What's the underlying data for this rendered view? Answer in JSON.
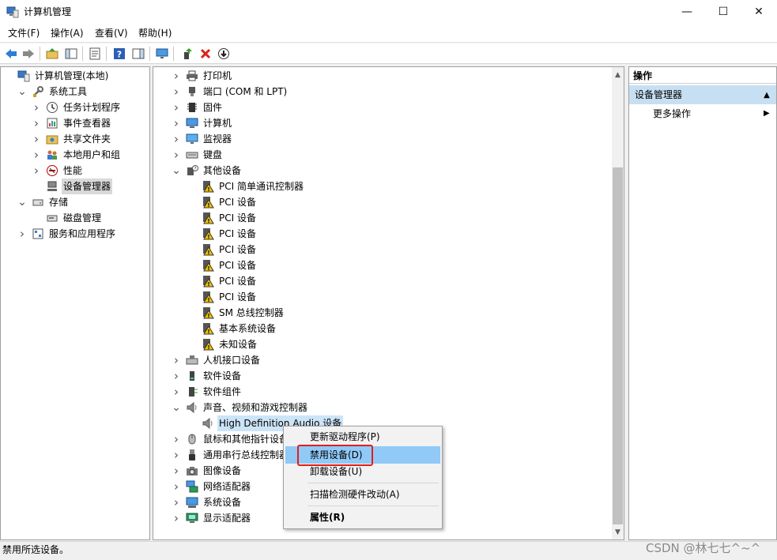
{
  "window": {
    "title": "计算机管理",
    "minimize": "—",
    "maximize": "☐",
    "close": "✕"
  },
  "menu": [
    "文件(F)",
    "操作(A)",
    "查看(V)",
    "帮助(H)"
  ],
  "toolbar": {
    "icons": [
      "back-arrow-icon",
      "forward-arrow-icon",
      "up-folder-icon",
      "show-hide-tree-icon",
      "properties-icon",
      "help-icon",
      "show-action-pane-icon",
      "monitor-icon",
      "update-driver-icon",
      "uninstall-icon",
      "disable-device-icon"
    ]
  },
  "left_tree": [
    {
      "label": "计算机管理(本地)",
      "icon": "computer-management-icon",
      "level": 0,
      "arrow": ""
    },
    {
      "label": "系统工具",
      "icon": "system-tools-icon",
      "level": 1,
      "arrow": "v"
    },
    {
      "label": "任务计划程序",
      "icon": "clock-icon",
      "level": 2,
      "arrow": ">"
    },
    {
      "label": "事件查看器",
      "icon": "event-viewer-icon",
      "level": 2,
      "arrow": ">"
    },
    {
      "label": "共享文件夹",
      "icon": "shared-folder-icon",
      "level": 2,
      "arrow": ">"
    },
    {
      "label": "本地用户和组",
      "icon": "users-icon",
      "level": 2,
      "arrow": ">"
    },
    {
      "label": "性能",
      "icon": "performance-icon",
      "level": 2,
      "arrow": ">"
    },
    {
      "label": "设备管理器",
      "icon": "device-manager-icon",
      "level": 2,
      "arrow": "",
      "selected": true
    },
    {
      "label": "存储",
      "icon": "storage-icon",
      "level": 1,
      "arrow": "v"
    },
    {
      "label": "磁盘管理",
      "icon": "disk-management-icon",
      "level": 2,
      "arrow": ""
    },
    {
      "label": "服务和应用程序",
      "icon": "services-icon",
      "level": 1,
      "arrow": ">"
    }
  ],
  "device_tree": [
    {
      "label": "打印机",
      "icon": "printer-icon",
      "level": 0,
      "arrow": ">"
    },
    {
      "label": "端口 (COM 和 LPT)",
      "icon": "port-icon",
      "level": 0,
      "arrow": ">"
    },
    {
      "label": "固件",
      "icon": "firmware-icon",
      "level": 0,
      "arrow": ">"
    },
    {
      "label": "计算机",
      "icon": "computer-icon",
      "level": 0,
      "arrow": ">"
    },
    {
      "label": "监视器",
      "icon": "monitor-icon",
      "level": 0,
      "arrow": ">"
    },
    {
      "label": "键盘",
      "icon": "keyboard-icon",
      "level": 0,
      "arrow": ">"
    },
    {
      "label": "其他设备",
      "icon": "other-devices-icon",
      "level": 0,
      "arrow": "v"
    },
    {
      "label": "PCI 简单通讯控制器",
      "icon": "warning-device-icon",
      "level": 1,
      "arrow": ""
    },
    {
      "label": "PCI 设备",
      "icon": "warning-device-icon",
      "level": 1,
      "arrow": ""
    },
    {
      "label": "PCI 设备",
      "icon": "warning-device-icon",
      "level": 1,
      "arrow": ""
    },
    {
      "label": "PCI 设备",
      "icon": "warning-device-icon",
      "level": 1,
      "arrow": ""
    },
    {
      "label": "PCI 设备",
      "icon": "warning-device-icon",
      "level": 1,
      "arrow": ""
    },
    {
      "label": "PCI 设备",
      "icon": "warning-device-icon",
      "level": 1,
      "arrow": ""
    },
    {
      "label": "PCI 设备",
      "icon": "warning-device-icon",
      "level": 1,
      "arrow": ""
    },
    {
      "label": "PCI 设备",
      "icon": "warning-device-icon",
      "level": 1,
      "arrow": ""
    },
    {
      "label": "SM 总线控制器",
      "icon": "warning-device-icon",
      "level": 1,
      "arrow": ""
    },
    {
      "label": "基本系统设备",
      "icon": "warning-device-icon",
      "level": 1,
      "arrow": ""
    },
    {
      "label": "未知设备",
      "icon": "warning-device-icon",
      "level": 1,
      "arrow": ""
    },
    {
      "label": "人机接口设备",
      "icon": "hid-icon",
      "level": 0,
      "arrow": ">"
    },
    {
      "label": "软件设备",
      "icon": "software-device-icon",
      "level": 0,
      "arrow": ">"
    },
    {
      "label": "软件组件",
      "icon": "software-component-icon",
      "level": 0,
      "arrow": ">"
    },
    {
      "label": "声音、视频和游戏控制器",
      "icon": "speaker-icon",
      "level": 0,
      "arrow": "v"
    },
    {
      "label": "High Definition Audio 设备",
      "icon": "speaker-icon",
      "level": 1,
      "arrow": "",
      "selected": true
    },
    {
      "label": "鼠标和其他指针设备",
      "icon": "mouse-icon",
      "level": 0,
      "arrow": ">"
    },
    {
      "label": "通用串行总线控制器",
      "icon": "usb-icon",
      "level": 0,
      "arrow": ">"
    },
    {
      "label": "图像设备",
      "icon": "camera-icon",
      "level": 0,
      "arrow": ">"
    },
    {
      "label": "网络适配器",
      "icon": "network-icon",
      "level": 0,
      "arrow": ">"
    },
    {
      "label": "系统设备",
      "icon": "system-device-icon",
      "level": 0,
      "arrow": ">"
    },
    {
      "label": "显示适配器",
      "icon": "display-adapter-icon",
      "level": 0,
      "arrow": ">"
    }
  ],
  "actions_pane": {
    "header": "操作",
    "section": "设备管理器",
    "section_arrow": "▲",
    "more": "更多操作",
    "more_arrow": "▶"
  },
  "context_menu": {
    "update": "更新驱动程序(P)",
    "disable": "禁用设备(D)",
    "uninstall": "卸载设备(U)",
    "scan": "扫描检测硬件改动(A)",
    "properties": "属性(R)"
  },
  "status": "禁用所选设备。",
  "watermark": "CSDN @林七七^~^",
  "colors": {
    "highlight": "#91c9f7",
    "selection": "#d9d9d9",
    "section": "#c7dff2",
    "annotation_box": "#e0201c"
  }
}
